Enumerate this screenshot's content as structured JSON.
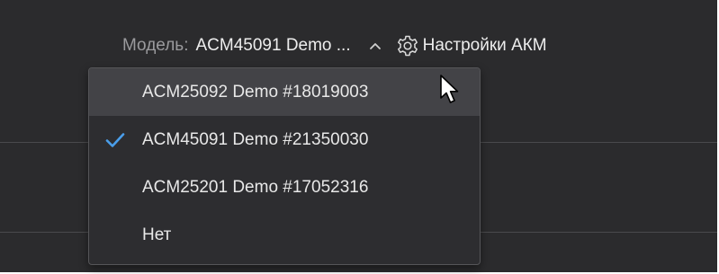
{
  "toolbar": {
    "model_label": "Модель:",
    "model_value": "ACM45091 Demo ...",
    "chevron_icon": "chevron-up-icon",
    "settings_icon": "gear-icon",
    "settings_label": "Настройки АКМ"
  },
  "dropdown": {
    "items": [
      {
        "label": "ACM25092 Demo #18019003",
        "selected": false,
        "hovered": true
      },
      {
        "label": "ACM45091 Demo #21350030",
        "selected": true,
        "hovered": false
      },
      {
        "label": "ACM25201 Demo #17052316",
        "selected": false,
        "hovered": false
      },
      {
        "label": "Нет",
        "selected": false,
        "hovered": false
      }
    ],
    "check_icon": "checkmark-icon"
  },
  "cursor_icon": "mouse-pointer-icon",
  "colors": {
    "background": "#2b2b2d",
    "dropdown_background": "#2d2d30",
    "hover_background": "#434347",
    "text": "#ededed",
    "label_text": "#9a9a9d",
    "accent_check": "#4a9eea"
  }
}
